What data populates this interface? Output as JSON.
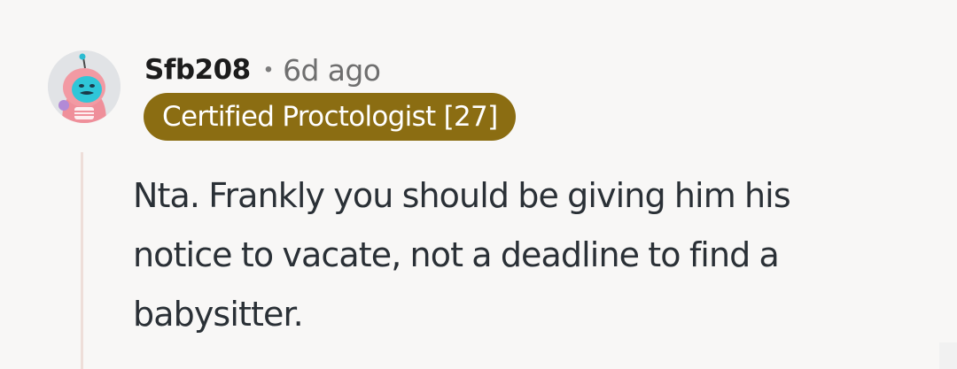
{
  "comment": {
    "username": "Sfb208",
    "separator": "•",
    "timestamp": "6d ago",
    "flair": "Certified Proctologist [27]",
    "body_lines": [
      "Nta. Frankly you should be giving him his",
      "notice to vacate, not a deadline to find a",
      "babysitter."
    ],
    "avatar_icon": "snoo-avatar-icon"
  },
  "colors": {
    "flair_background": "#8b6d12",
    "flair_text": "#ffffff",
    "thread_line": "#eeded9",
    "body_text": "#2a3036",
    "background": "#f8f7f6"
  }
}
